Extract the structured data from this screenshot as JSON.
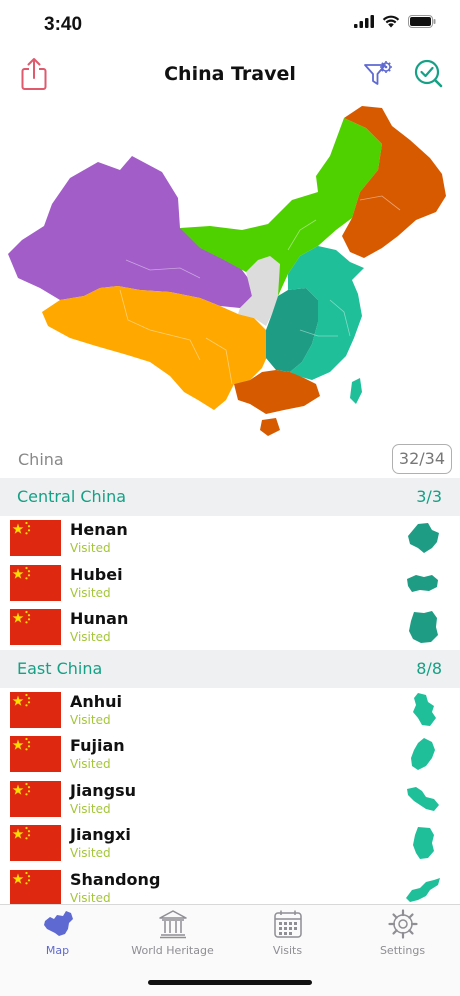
{
  "status_bar": {
    "time": "3:40"
  },
  "nav": {
    "title": "China Travel"
  },
  "map": {
    "regions": [
      {
        "name": "northwest",
        "color": "#a25dc9"
      },
      {
        "name": "north",
        "color": "#4fd100"
      },
      {
        "name": "northeast",
        "color": "#d85a00"
      },
      {
        "name": "southwest",
        "color": "#ffa800"
      },
      {
        "name": "central",
        "color": "#1f9c84"
      },
      {
        "name": "east",
        "color": "#1fbf9a"
      },
      {
        "name": "south",
        "color": "#d65a00"
      },
      {
        "name": "unvisited",
        "color": "#dcdcdc"
      }
    ]
  },
  "country": {
    "name": "China",
    "count": "32/34"
  },
  "sections": [
    {
      "title": "Central China",
      "count": "3/3",
      "items": [
        {
          "name": "Henan",
          "status": "Visited"
        },
        {
          "name": "Hubei",
          "status": "Visited"
        },
        {
          "name": "Hunan",
          "status": "Visited"
        }
      ]
    },
    {
      "title": "East China",
      "count": "8/8",
      "items": [
        {
          "name": "Anhui",
          "status": "Visited"
        },
        {
          "name": "Fujian",
          "status": "Visited"
        },
        {
          "name": "Jiangsu",
          "status": "Visited"
        },
        {
          "name": "Jiangxi",
          "status": "Visited"
        },
        {
          "name": "Shandong",
          "status": "Visited"
        }
      ]
    }
  ],
  "tabs": [
    {
      "label": "Map",
      "icon": "china-map-icon",
      "active": true
    },
    {
      "label": "World Heritage",
      "icon": "temple-icon",
      "active": false
    },
    {
      "label": "Visits",
      "icon": "calendar-icon",
      "active": false
    },
    {
      "label": "Settings",
      "icon": "gear-icon",
      "active": false
    }
  ],
  "colors": {
    "accent": "#16a085",
    "visited": "#a4c639",
    "tab_active": "#5e6ad2",
    "share_icon": "#e05a6e",
    "flag_red": "#de2910",
    "flag_star": "#ffde00"
  }
}
